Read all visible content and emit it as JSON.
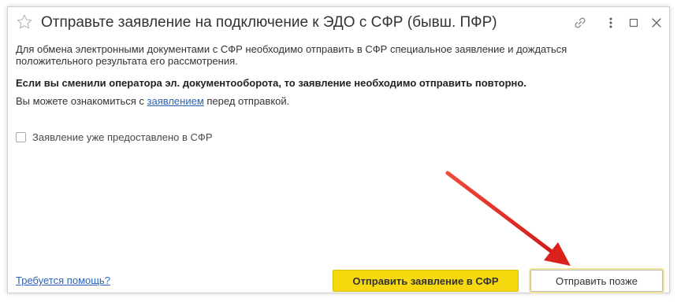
{
  "dialog": {
    "title": "Отправьте заявление на подключение к ЭДО с СФР (бывш. ПФР)",
    "paragraph1": "Для обмена электронными документами с СФР необходимо отправить в СФР специальное заявление и дождаться положительного результата его рассмотрения.",
    "paragraph2": "Если вы сменили оператора эл. документооборота, то заявление необходимо отправить повторно.",
    "paragraph3_before": "Вы можете ознакомиться с ",
    "paragraph3_link": "заявлением",
    "paragraph3_after": " перед отправкой.",
    "checkbox_label": "Заявление уже предоставлено в СФР",
    "checkbox_checked": false
  },
  "footer": {
    "help_link": "Требуется помощь?",
    "send_button": "Отправить заявление в СФР",
    "later_button": "Отправить позже"
  },
  "icons": {
    "favorite": "star-icon",
    "link": "link-icon",
    "more": "more-vertical-icon",
    "maximize": "maximize-icon",
    "close": "close-icon"
  },
  "colors": {
    "primary_button": "#f6d90f",
    "link": "#2b63b5",
    "annotation_arrow": "#e02020"
  }
}
